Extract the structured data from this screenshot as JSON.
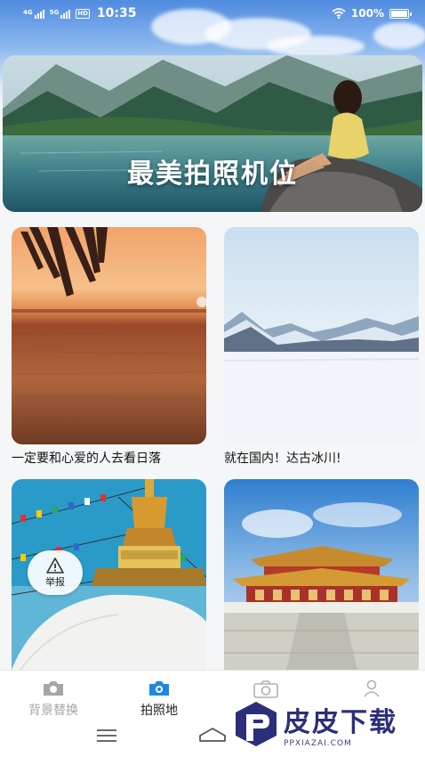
{
  "status_bar": {
    "signal_1": "4G",
    "signal_2": "5G",
    "hd": "HD",
    "time": "10:35",
    "battery": "100%"
  },
  "banner": {
    "title": "最美拍照机位"
  },
  "cards": [
    {
      "caption": "一定要和心爱的人去看日落"
    },
    {
      "caption": "就在国内！达古冰川!"
    },
    {
      "caption": ""
    },
    {
      "caption": ""
    }
  ],
  "report": {
    "label": "举报"
  },
  "nav": [
    {
      "label": "背景替换",
      "icon": "camera-icon",
      "active": false
    },
    {
      "label": "拍照地",
      "icon": "camera-icon",
      "active": true
    },
    {
      "label": "",
      "icon": "camera-frame-icon",
      "active": false
    },
    {
      "label": "",
      "icon": "user-icon",
      "active": false
    }
  ],
  "watermark": {
    "title": "皮皮下载",
    "url": "PPXIAZAI.COM"
  },
  "colors": {
    "accent": "#1e88e5",
    "watermark": "#2b2f7a",
    "nav_inactive": "#a6a6a6"
  }
}
